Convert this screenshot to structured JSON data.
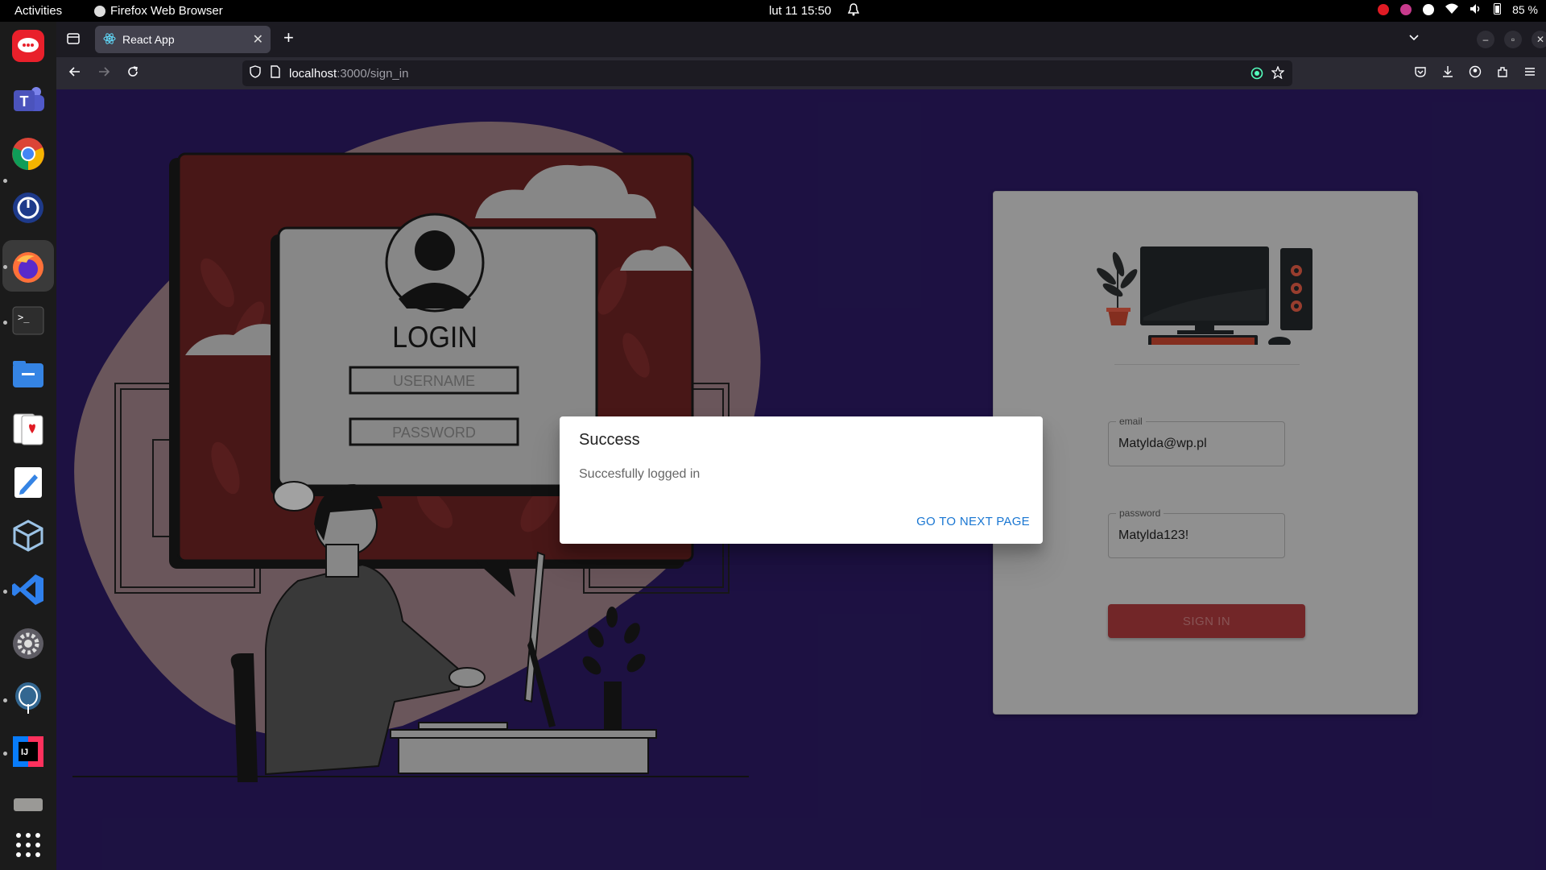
{
  "topbar": {
    "activities": "Activities",
    "app_name": "Firefox Web Browser",
    "clock": "lut 11  15:50",
    "battery": "85 %"
  },
  "dock": {
    "apps": [
      "rocketchat-icon",
      "teams-icon",
      "chrome-icon",
      "timer-icon",
      "firefox-icon",
      "terminal-icon",
      "files-icon",
      "solitaire-icon",
      "text-editor-icon",
      "virtualbox-icon",
      "vscode-icon",
      "settings-icon",
      "postgres-icon",
      "intellij-icon",
      "disk-icon",
      "app-grid-icon"
    ]
  },
  "browser": {
    "tab_title": "React App",
    "url_host": "localhost",
    "url_path": ":3000/sign_in"
  },
  "illustration": {
    "login_heading": "LOGIN",
    "username_placeholder": "USERNAME",
    "password_placeholder": "PASSWORD"
  },
  "form": {
    "email_label": "email",
    "email_value": "Matylda@wp.pl",
    "password_label": "password",
    "password_value": "Matylda123!",
    "signin_label": "SIGN IN"
  },
  "dialog": {
    "title": "Success",
    "message": "Succesfully logged in",
    "action": "GO TO NEXT PAGE"
  }
}
